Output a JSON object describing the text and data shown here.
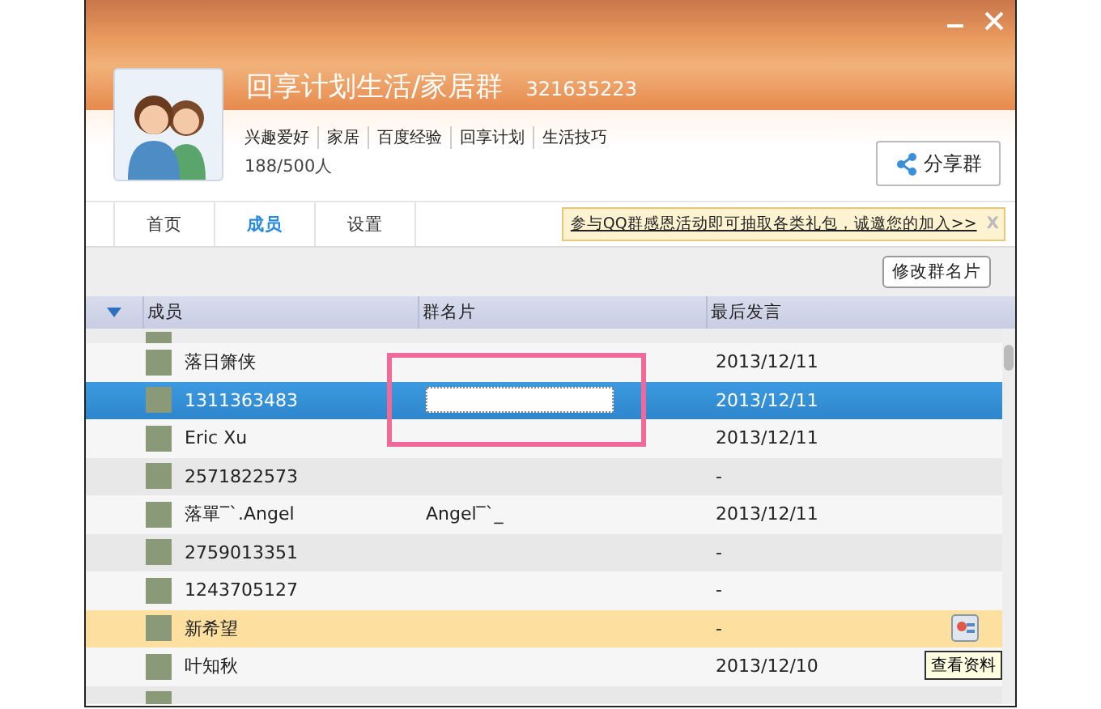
{
  "header": {
    "title": "回享计划生活/家居群",
    "group_number": "321635223",
    "tags": [
      "兴趣爱好",
      "家居",
      "百度经验",
      "回享计划",
      "生活技巧"
    ],
    "member_count": "188/500人",
    "share_button": "分享群"
  },
  "tabs": [
    {
      "label": "首页",
      "selected": false
    },
    {
      "label": "成员",
      "selected": true
    },
    {
      "label": "设置",
      "selected": false
    }
  ],
  "notice": {
    "text": "参与QQ群感恩活动即可抽取各类礼包，诚邀您的加入>>",
    "close": "X"
  },
  "toolbar": {
    "button": "修改群名片"
  },
  "table": {
    "columns": [
      "成员",
      "群名片",
      "最后发言"
    ],
    "rows": [
      {
        "name": "落日箫侠",
        "card": "",
        "last_post": "2013/12/11",
        "selected": false,
        "hovered": false
      },
      {
        "name": "1311363483",
        "card": "",
        "last_post": "2013/12/11",
        "selected": true,
        "hovered": false,
        "editing": true
      },
      {
        "name": "Eric Xu",
        "card": "",
        "last_post": "2013/12/11",
        "selected": false,
        "hovered": false
      },
      {
        "name": "2571822573",
        "card": "",
        "last_post": "-",
        "selected": false,
        "hovered": false
      },
      {
        "name": "落單‾ˋ.Angel",
        "card": "Angel‾ˋ_",
        "last_post": "2013/12/11",
        "selected": false,
        "hovered": false
      },
      {
        "name": "2759013351",
        "card": "",
        "last_post": "-",
        "selected": false,
        "hovered": false
      },
      {
        "name": "1243705127",
        "card": "",
        "last_post": "-",
        "selected": false,
        "hovered": false
      },
      {
        "name": "新希望",
        "card": "",
        "last_post": "-",
        "selected": false,
        "hovered": true
      },
      {
        "name": "叶知秋",
        "card": "",
        "last_post": "2013/12/10",
        "selected": false,
        "hovered": false
      }
    ]
  },
  "tooltip": "查看资料"
}
